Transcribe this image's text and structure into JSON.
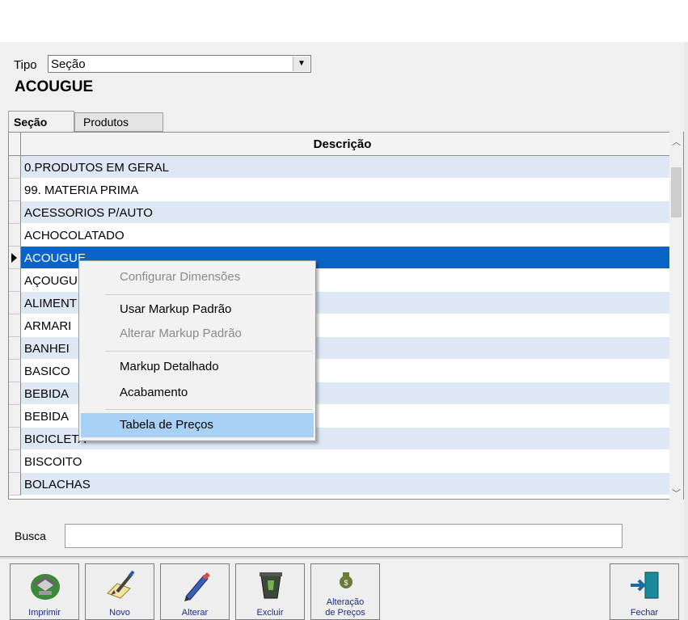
{
  "form": {
    "tipo_label": "Tipo",
    "tipo_value": "Seção",
    "section_name": "ACOUGUE"
  },
  "tabs": [
    {
      "label": "Seção",
      "active": true
    },
    {
      "label": "Produtos",
      "active": false
    }
  ],
  "grid": {
    "column_header": "Descrição",
    "selected_index": 4,
    "rows": [
      "0.PRODUTOS EM GERAL",
      "99. MATERIA PRIMA",
      "ACESSORIOS P/AUTO",
      "ACHOCOLATADO",
      "ACOUGUE",
      "AÇOUGUE",
      "ALIMENT",
      "ARMARI",
      "BANHEI",
      "BASICO",
      "BEBIDA",
      "BEBIDA",
      "BICICLETA",
      "BISCOITO",
      "BOLACHAS"
    ]
  },
  "context_menu": {
    "items": [
      {
        "label": "Configurar Dimensões",
        "disabled": true
      },
      {
        "label": "Usar Markup Padrão",
        "disabled": false
      },
      {
        "label": "Alterar Markup Padrão",
        "disabled": true
      },
      {
        "label": "Markup Detalhado",
        "disabled": false
      },
      {
        "label": "Acabamento",
        "disabled": false
      },
      {
        "label": "Tabela de Preços",
        "disabled": false,
        "highlighted": true
      }
    ]
  },
  "search": {
    "label": "Busca",
    "value": ""
  },
  "toolbar": {
    "imprimir": "Imprimir",
    "novo": "Novo",
    "alterar": "Alterar",
    "excluir": "Excluir",
    "alteracao_precos_1": "Alteração",
    "alteracao_precos_2": "de Preços",
    "fechar": "Fechar"
  },
  "colors": {
    "selection": "#0a64c8",
    "row_alt": "#dde8f4",
    "menu_highlight": "#a9d0f5",
    "toolbar_text": "#1a2a8a"
  }
}
